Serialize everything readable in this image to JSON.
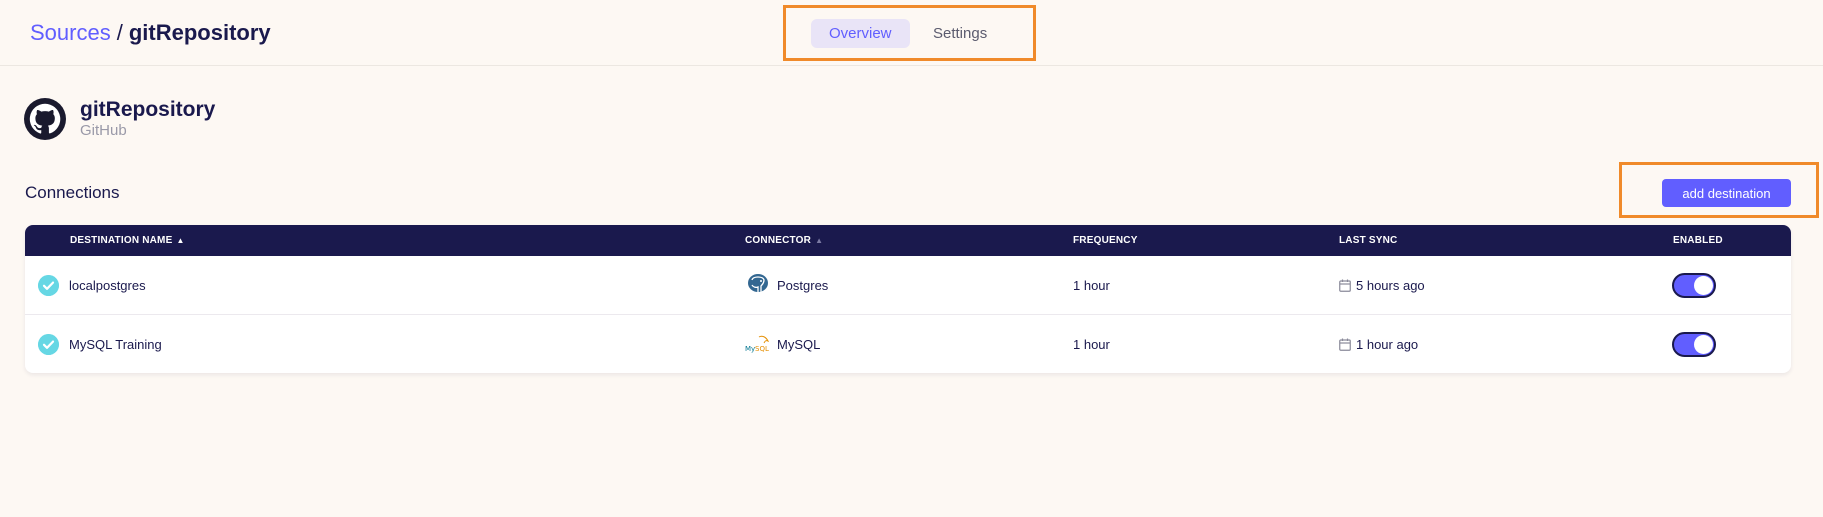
{
  "breadcrumb": {
    "parent": "Sources",
    "separator": "/",
    "current": "gitRepository"
  },
  "tabs": [
    {
      "label": "Overview",
      "active": true
    },
    {
      "label": "Settings",
      "active": false
    }
  ],
  "source": {
    "name": "gitRepository",
    "type": "GitHub",
    "icon": "github-icon"
  },
  "connections": {
    "title": "Connections",
    "add_button": "add destination",
    "columns": {
      "destination": "Destination Name",
      "connector": "Connector",
      "frequency": "Frequency",
      "last_sync": "Last Sync",
      "enabled": "Enabled"
    },
    "sorted_column": "destination",
    "rows": [
      {
        "destination": "localpostgres",
        "connector": "Postgres",
        "connector_icon": "postgres-icon",
        "frequency": "1 hour",
        "last_sync": "5 hours ago",
        "enabled": true
      },
      {
        "destination": "MySQL Training",
        "connector": "MySQL",
        "connector_icon": "mysql-icon",
        "frequency": "1 hour",
        "last_sync": "1 hour ago",
        "enabled": true
      }
    ]
  },
  "colors": {
    "accent": "#615eff",
    "header_bg": "#1a194d",
    "page_bg": "#fdf8f3",
    "success": "#66d7e4",
    "highlight": "#f08a2a"
  }
}
